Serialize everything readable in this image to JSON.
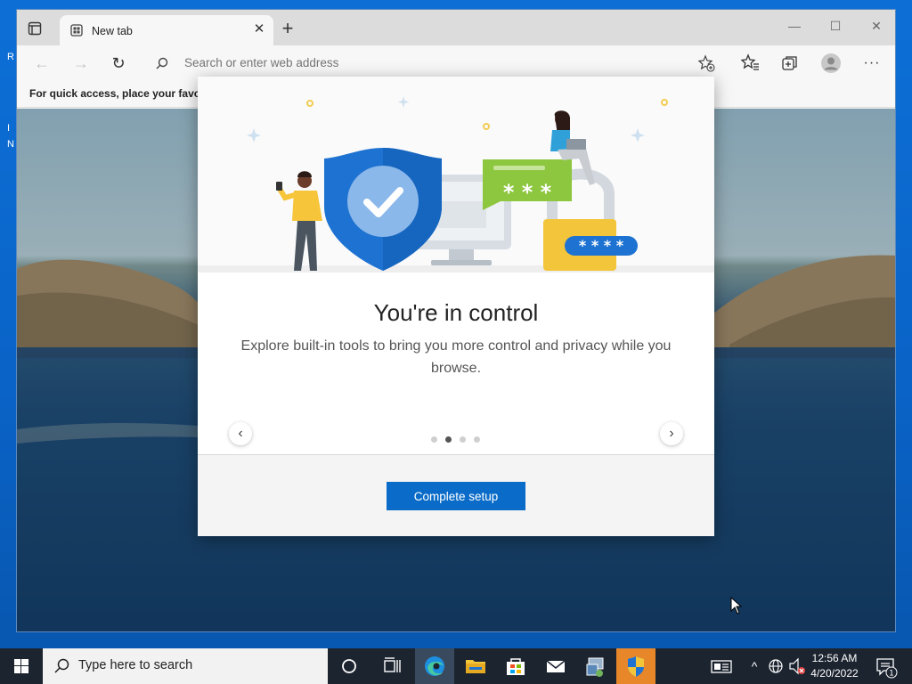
{
  "browser": {
    "tab": {
      "title": "New tab"
    },
    "address_bar": {
      "placeholder": "Search or enter web address"
    },
    "bookmarks_hint": "For quick access, place your favorit"
  },
  "modal": {
    "title": "You're in control",
    "description": "Explore built-in tools to bring you more control and privacy while you browse.",
    "carousel": {
      "total_pages": 4,
      "current_page": 2
    },
    "primary_button": "Complete setup",
    "illustration": {
      "password_mask_1": "* * *",
      "password_mask_2": "* * * *"
    }
  },
  "taskbar": {
    "search_placeholder": "Type here to search",
    "pinned": [
      "task-view-icon",
      "cortana-icon",
      "edge-icon",
      "file-explorer-icon",
      "store-icon",
      "mail-icon",
      "app-icon",
      "security-shield-icon"
    ],
    "active_app": "edge-icon",
    "clock": {
      "time": "12:56 AM",
      "date": "4/20/2022"
    },
    "notification_count": "1"
  },
  "colors": {
    "accent": "#0a6cc8",
    "taskbar": "#1c2430",
    "shield_blue": "#1e73d2",
    "lock_yellow": "#f3c53a",
    "chat_green": "#8dc63f"
  }
}
